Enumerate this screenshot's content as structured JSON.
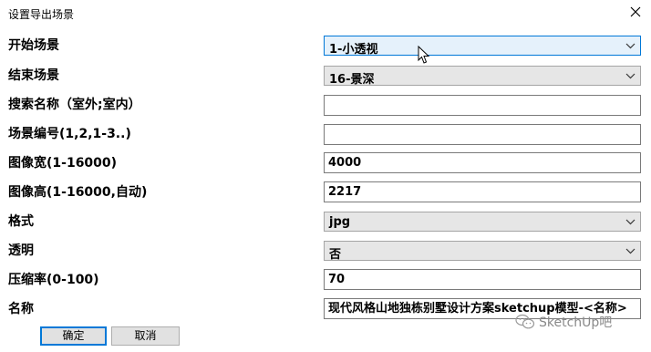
{
  "window": {
    "title": "设置导出场景",
    "close_glyph": "✕"
  },
  "rows": [
    {
      "label": "开始场景",
      "kind": "combo",
      "value": "1-小透视"
    },
    {
      "label": "结束场景",
      "kind": "combo",
      "value": "16-景深"
    },
    {
      "label": "搜索名称（室外;室内）",
      "kind": "input",
      "value": ""
    },
    {
      "label": "场景编号(1,2,1-3..)",
      "kind": "input",
      "value": ""
    },
    {
      "label": "图像宽(1-16000)",
      "kind": "input",
      "value": "4000"
    },
    {
      "label": "图像高(1-16000,自动)",
      "kind": "input",
      "value": "2217"
    },
    {
      "label": "格式",
      "kind": "combo",
      "value": "jpg"
    },
    {
      "label": "透明",
      "kind": "combo",
      "value": "否"
    },
    {
      "label": "压缩率(0-100)",
      "kind": "input",
      "value": "70"
    },
    {
      "label": "名称",
      "kind": "input",
      "value": "现代风格山地独栋别墅设计方案sketchup模型-<名称>"
    }
  ],
  "buttons": {
    "ok": "确定",
    "cancel": "取消"
  },
  "watermark": {
    "text": "SketchUp吧",
    "icon": "wechat-icon"
  },
  "colors": {
    "focus": "#0078d7",
    "combo_focus_bg": "#e5f1fb"
  }
}
